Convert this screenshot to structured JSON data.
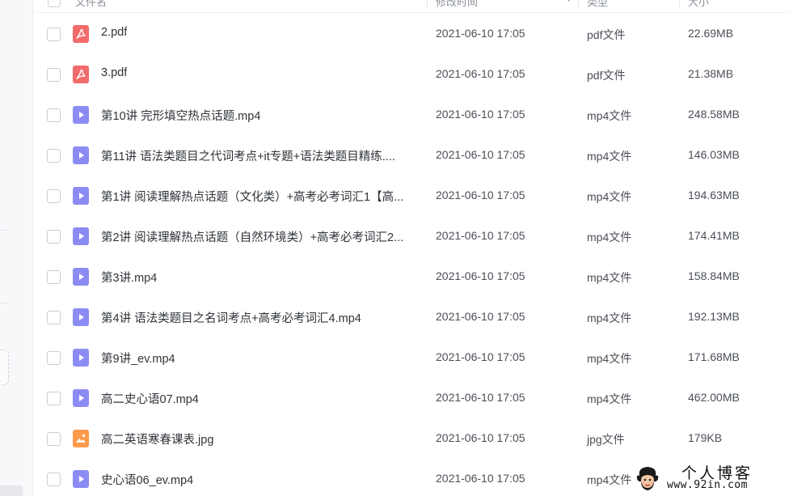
{
  "header": {
    "name_label": "文件名",
    "time_label": "修改时间",
    "type_label": "类型",
    "size_label": "大小"
  },
  "files": [
    {
      "name": "2.pdf",
      "time": "2021-06-10 17:05",
      "type": "pdf文件",
      "size": "22.69MB",
      "icon": "pdf-icon"
    },
    {
      "name": "3.pdf",
      "time": "2021-06-10 17:05",
      "type": "pdf文件",
      "size": "21.38MB",
      "icon": "pdf-icon"
    },
    {
      "name": "第10讲 完形填空热点话题.mp4",
      "time": "2021-06-10 17:05",
      "type": "mp4文件",
      "size": "248.58MB",
      "icon": "video-icon"
    },
    {
      "name": "第11讲 语法类题目之代词考点+it专题+语法类题目精练....",
      "time": "2021-06-10 17:05",
      "type": "mp4文件",
      "size": "146.03MB",
      "icon": "video-icon"
    },
    {
      "name": "第1讲 阅读理解热点话题（文化类）+高考必考词汇1【高...",
      "time": "2021-06-10 17:05",
      "type": "mp4文件",
      "size": "194.63MB",
      "icon": "video-icon"
    },
    {
      "name": "第2讲 阅读理解热点话题（自然环境类）+高考必考词汇2...",
      "time": "2021-06-10 17:05",
      "type": "mp4文件",
      "size": "174.41MB",
      "icon": "video-icon"
    },
    {
      "name": "第3讲.mp4",
      "time": "2021-06-10 17:05",
      "type": "mp4文件",
      "size": "158.84MB",
      "icon": "video-icon"
    },
    {
      "name": "第4讲 语法类题目之名词考点+高考必考词汇4.mp4",
      "time": "2021-06-10 17:05",
      "type": "mp4文件",
      "size": "192.13MB",
      "icon": "video-icon"
    },
    {
      "name": "第9讲_ev.mp4",
      "time": "2021-06-10 17:05",
      "type": "mp4文件",
      "size": "171.68MB",
      "icon": "video-icon"
    },
    {
      "name": "高二史心语07.mp4",
      "time": "2021-06-10 17:05",
      "type": "mp4文件",
      "size": "462.00MB",
      "icon": "video-icon"
    },
    {
      "name": "高二英语寒春课表.jpg",
      "time": "2021-06-10 17:05",
      "type": "jpg文件",
      "size": "179KB",
      "icon": "image-icon"
    },
    {
      "name": "史心语06_ev.mp4",
      "time": "2021-06-10 17:05",
      "type": "mp4文件",
      "size": "",
      "icon": "video-icon"
    }
  ],
  "colors": {
    "pdf": "#f26b6b",
    "video": "#8b8cf3",
    "image": "#ff9a4d",
    "checkbox_border": "#c9cdd2"
  },
  "watermark": {
    "title": "个人博客",
    "url": "www.92in.com"
  }
}
